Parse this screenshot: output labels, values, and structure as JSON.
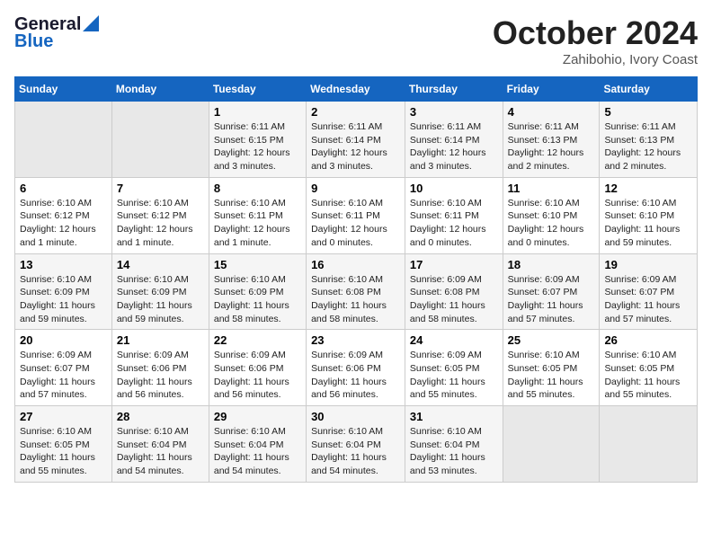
{
  "header": {
    "logo_line1": "General",
    "logo_line2": "Blue",
    "month": "October 2024",
    "location": "Zahibohio, Ivory Coast"
  },
  "days_of_week": [
    "Sunday",
    "Monday",
    "Tuesday",
    "Wednesday",
    "Thursday",
    "Friday",
    "Saturday"
  ],
  "weeks": [
    [
      {
        "day": "",
        "content": ""
      },
      {
        "day": "",
        "content": ""
      },
      {
        "day": "1",
        "content": "Sunrise: 6:11 AM\nSunset: 6:15 PM\nDaylight: 12 hours and 3 minutes."
      },
      {
        "day": "2",
        "content": "Sunrise: 6:11 AM\nSunset: 6:14 PM\nDaylight: 12 hours and 3 minutes."
      },
      {
        "day": "3",
        "content": "Sunrise: 6:11 AM\nSunset: 6:14 PM\nDaylight: 12 hours and 3 minutes."
      },
      {
        "day": "4",
        "content": "Sunrise: 6:11 AM\nSunset: 6:13 PM\nDaylight: 12 hours and 2 minutes."
      },
      {
        "day": "5",
        "content": "Sunrise: 6:11 AM\nSunset: 6:13 PM\nDaylight: 12 hours and 2 minutes."
      }
    ],
    [
      {
        "day": "6",
        "content": "Sunrise: 6:10 AM\nSunset: 6:12 PM\nDaylight: 12 hours and 1 minute."
      },
      {
        "day": "7",
        "content": "Sunrise: 6:10 AM\nSunset: 6:12 PM\nDaylight: 12 hours and 1 minute."
      },
      {
        "day": "8",
        "content": "Sunrise: 6:10 AM\nSunset: 6:11 PM\nDaylight: 12 hours and 1 minute."
      },
      {
        "day": "9",
        "content": "Sunrise: 6:10 AM\nSunset: 6:11 PM\nDaylight: 12 hours and 0 minutes."
      },
      {
        "day": "10",
        "content": "Sunrise: 6:10 AM\nSunset: 6:11 PM\nDaylight: 12 hours and 0 minutes."
      },
      {
        "day": "11",
        "content": "Sunrise: 6:10 AM\nSunset: 6:10 PM\nDaylight: 12 hours and 0 minutes."
      },
      {
        "day": "12",
        "content": "Sunrise: 6:10 AM\nSunset: 6:10 PM\nDaylight: 11 hours and 59 minutes."
      }
    ],
    [
      {
        "day": "13",
        "content": "Sunrise: 6:10 AM\nSunset: 6:09 PM\nDaylight: 11 hours and 59 minutes."
      },
      {
        "day": "14",
        "content": "Sunrise: 6:10 AM\nSunset: 6:09 PM\nDaylight: 11 hours and 59 minutes."
      },
      {
        "day": "15",
        "content": "Sunrise: 6:10 AM\nSunset: 6:09 PM\nDaylight: 11 hours and 58 minutes."
      },
      {
        "day": "16",
        "content": "Sunrise: 6:10 AM\nSunset: 6:08 PM\nDaylight: 11 hours and 58 minutes."
      },
      {
        "day": "17",
        "content": "Sunrise: 6:09 AM\nSunset: 6:08 PM\nDaylight: 11 hours and 58 minutes."
      },
      {
        "day": "18",
        "content": "Sunrise: 6:09 AM\nSunset: 6:07 PM\nDaylight: 11 hours and 57 minutes."
      },
      {
        "day": "19",
        "content": "Sunrise: 6:09 AM\nSunset: 6:07 PM\nDaylight: 11 hours and 57 minutes."
      }
    ],
    [
      {
        "day": "20",
        "content": "Sunrise: 6:09 AM\nSunset: 6:07 PM\nDaylight: 11 hours and 57 minutes."
      },
      {
        "day": "21",
        "content": "Sunrise: 6:09 AM\nSunset: 6:06 PM\nDaylight: 11 hours and 56 minutes."
      },
      {
        "day": "22",
        "content": "Sunrise: 6:09 AM\nSunset: 6:06 PM\nDaylight: 11 hours and 56 minutes."
      },
      {
        "day": "23",
        "content": "Sunrise: 6:09 AM\nSunset: 6:06 PM\nDaylight: 11 hours and 56 minutes."
      },
      {
        "day": "24",
        "content": "Sunrise: 6:09 AM\nSunset: 6:05 PM\nDaylight: 11 hours and 55 minutes."
      },
      {
        "day": "25",
        "content": "Sunrise: 6:10 AM\nSunset: 6:05 PM\nDaylight: 11 hours and 55 minutes."
      },
      {
        "day": "26",
        "content": "Sunrise: 6:10 AM\nSunset: 6:05 PM\nDaylight: 11 hours and 55 minutes."
      }
    ],
    [
      {
        "day": "27",
        "content": "Sunrise: 6:10 AM\nSunset: 6:05 PM\nDaylight: 11 hours and 55 minutes."
      },
      {
        "day": "28",
        "content": "Sunrise: 6:10 AM\nSunset: 6:04 PM\nDaylight: 11 hours and 54 minutes."
      },
      {
        "day": "29",
        "content": "Sunrise: 6:10 AM\nSunset: 6:04 PM\nDaylight: 11 hours and 54 minutes."
      },
      {
        "day": "30",
        "content": "Sunrise: 6:10 AM\nSunset: 6:04 PM\nDaylight: 11 hours and 54 minutes."
      },
      {
        "day": "31",
        "content": "Sunrise: 6:10 AM\nSunset: 6:04 PM\nDaylight: 11 hours and 53 minutes."
      },
      {
        "day": "",
        "content": ""
      },
      {
        "day": "",
        "content": ""
      }
    ]
  ]
}
